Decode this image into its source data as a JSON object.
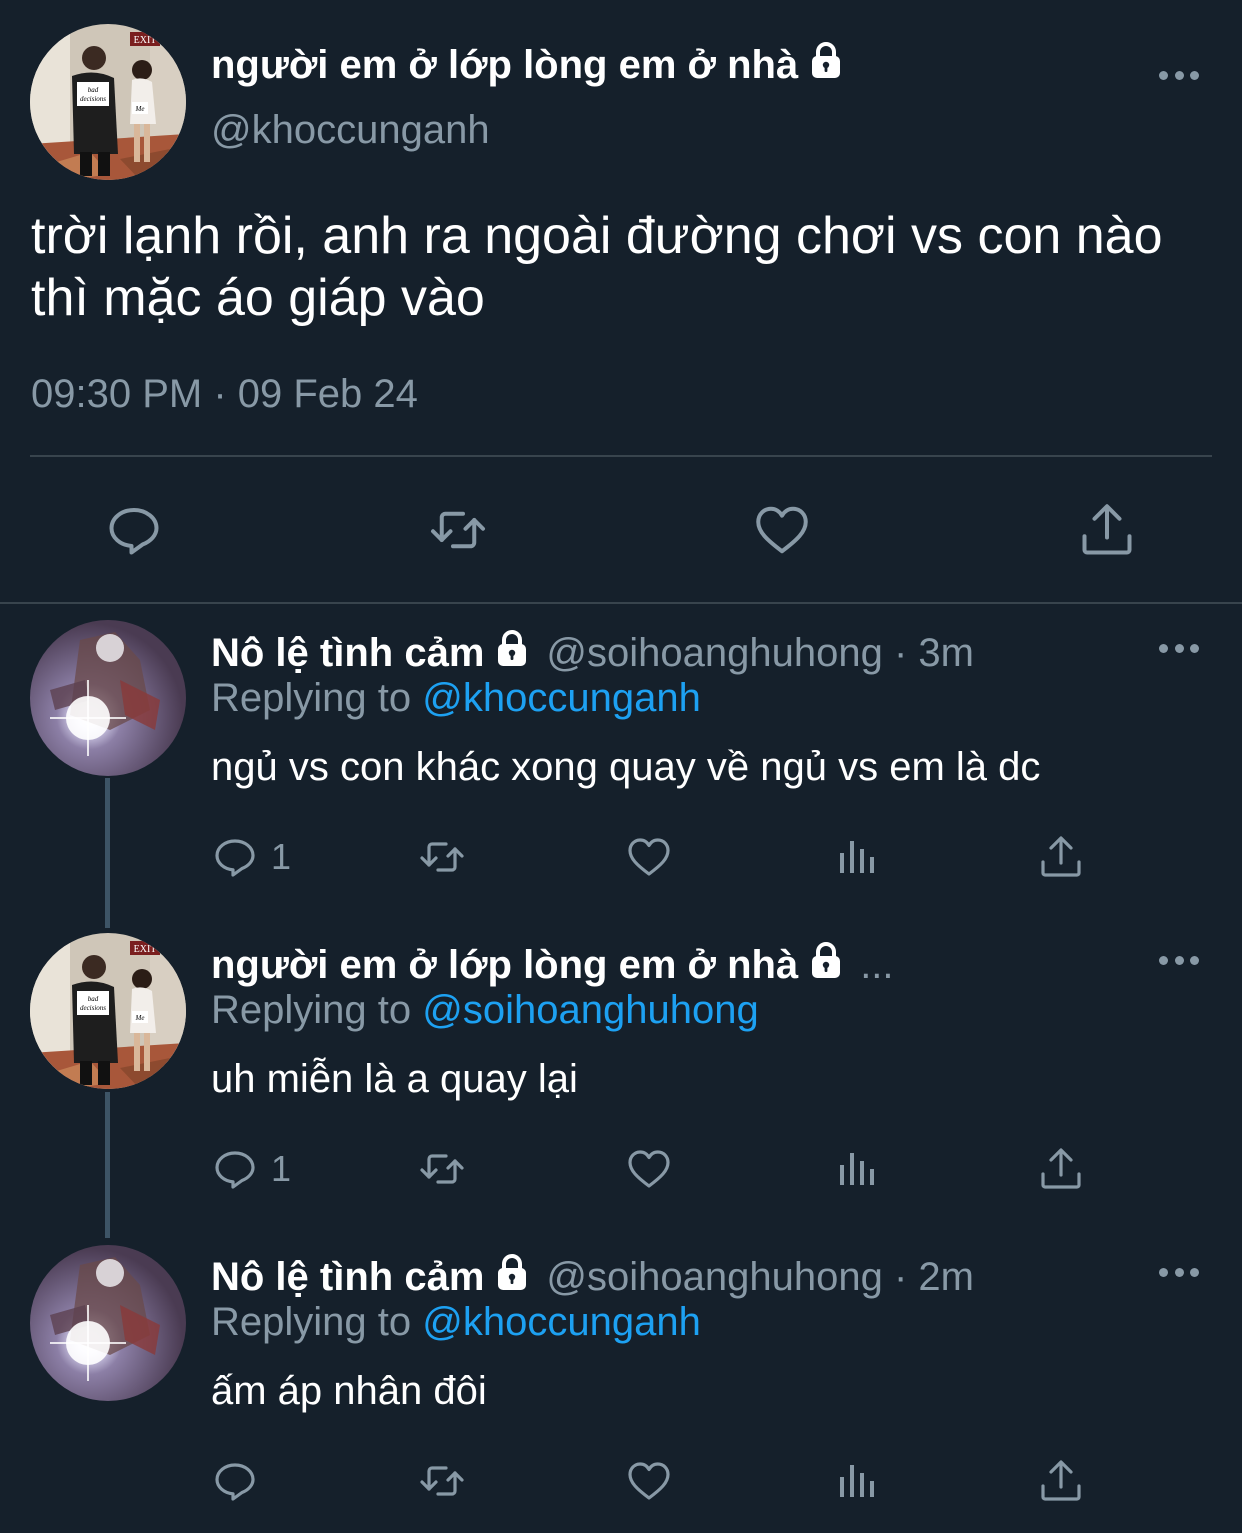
{
  "main_tweet": {
    "display_name": "người em ở lớp lòng em ở nhà",
    "handle": "@khoccunganh",
    "text": "trời lạnh rồi, anh ra ngoài đường chơi vs con nào thì mặc áo giáp vào",
    "timestamp": "09:30 PM · 09 Feb 24",
    "avatar_labels": [
      "bad decisions",
      "Me",
      "EXIT"
    ],
    "actions": [
      "comment-icon",
      "retweet-icon",
      "like-icon",
      "share-icon"
    ]
  },
  "replies": [
    {
      "display_name": "Nô lệ tình cảm",
      "meta": "@soihoanghuhong · 3m",
      "replying_prefix": "Replying to",
      "replying_to": "@khoccunganh",
      "text": "ngủ vs con khác xong quay về ngủ vs em là dc",
      "reply_count": "1"
    },
    {
      "display_name": "người em ở lớp lòng em ở nhà",
      "meta": "...",
      "replying_prefix": "Replying to",
      "replying_to": "@soihoanghuhong",
      "text": "uh miễn là a quay lại",
      "reply_count": "1"
    },
    {
      "display_name": "Nô lệ tình cảm",
      "meta": "@soihoanghuhong · 2m",
      "replying_prefix": "Replying to",
      "replying_to": "@khoccunganh",
      "text": "ấm áp nhân đôi",
      "reply_count": ""
    }
  ],
  "colors": {
    "background": "#15202b",
    "secondary_text": "#8899a6",
    "link": "#1da1f2",
    "divider": "#38444d",
    "thread_line": "#3d5466"
  }
}
